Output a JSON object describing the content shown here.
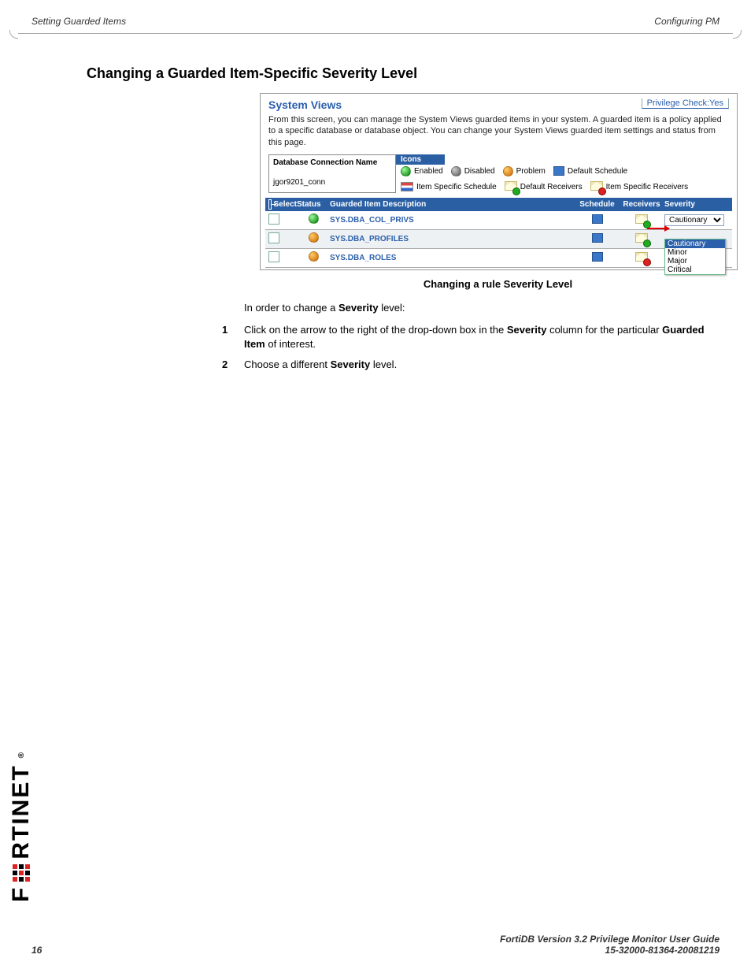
{
  "header": {
    "left": "Setting Guarded Items",
    "right": "Configuring PM"
  },
  "section_title": "Changing a Guarded Item-Specific Severity Level",
  "screenshot": {
    "title": "System Views",
    "privilege_link": "Privilege Check:Yes",
    "description": "From this screen, you can manage the System Views guarded items in your system. A guarded item is a policy applied to a specific database or database object. You can change your System Views guarded item settings and status from this page.",
    "db_conn_label": "Database Connection Name",
    "db_conn_value": "jgor9201_conn",
    "icons_header": "Icons",
    "legend": {
      "enabled": "Enabled",
      "disabled": "Disabled",
      "problem": "Problem",
      "default_schedule": "Default Schedule",
      "item_specific_schedule": "Item Specific Schedule",
      "default_receivers": "Default Receivers",
      "item_specific_receivers": "Item Specific Receivers"
    },
    "grid_headers": {
      "select": "Select",
      "status": "Status",
      "desc": "Guarded Item Description",
      "schedule": "Schedule",
      "receivers": "Receivers",
      "severity": "Severity"
    },
    "rows": [
      {
        "desc": "SYS.DBA_COL_PRIVS",
        "severity": "Cautionary"
      },
      {
        "desc": "SYS.DBA_PROFILES",
        "severity": ""
      },
      {
        "desc": "SYS.DBA_ROLES",
        "severity": ""
      }
    ],
    "severity_options": {
      "cautionary": "Cautionary",
      "minor": "Minor",
      "major": "Major",
      "critical": "Critical"
    }
  },
  "caption": "Changing a rule Severity Level",
  "intro": {
    "p1a": "In order to change a ",
    "p1b": "Severity",
    "p1c": " level:"
  },
  "steps": {
    "s1": {
      "num": "1",
      "a": "Click on the arrow to the right of the drop-down box in the ",
      "b": "Severity",
      "c": " column for the particular ",
      "d": "Guarded Item",
      "e": " of interest."
    },
    "s2": {
      "num": "2",
      "a": "Choose a different ",
      "b": "Severity",
      "c": " level."
    }
  },
  "footer": {
    "page": "16",
    "line1": "FortiDB Version 3.2 Privilege Monitor  User Guide",
    "line2": "15-32000-81364-20081219"
  },
  "logo": {
    "text": "F",
    "text2": "RTINET"
  }
}
